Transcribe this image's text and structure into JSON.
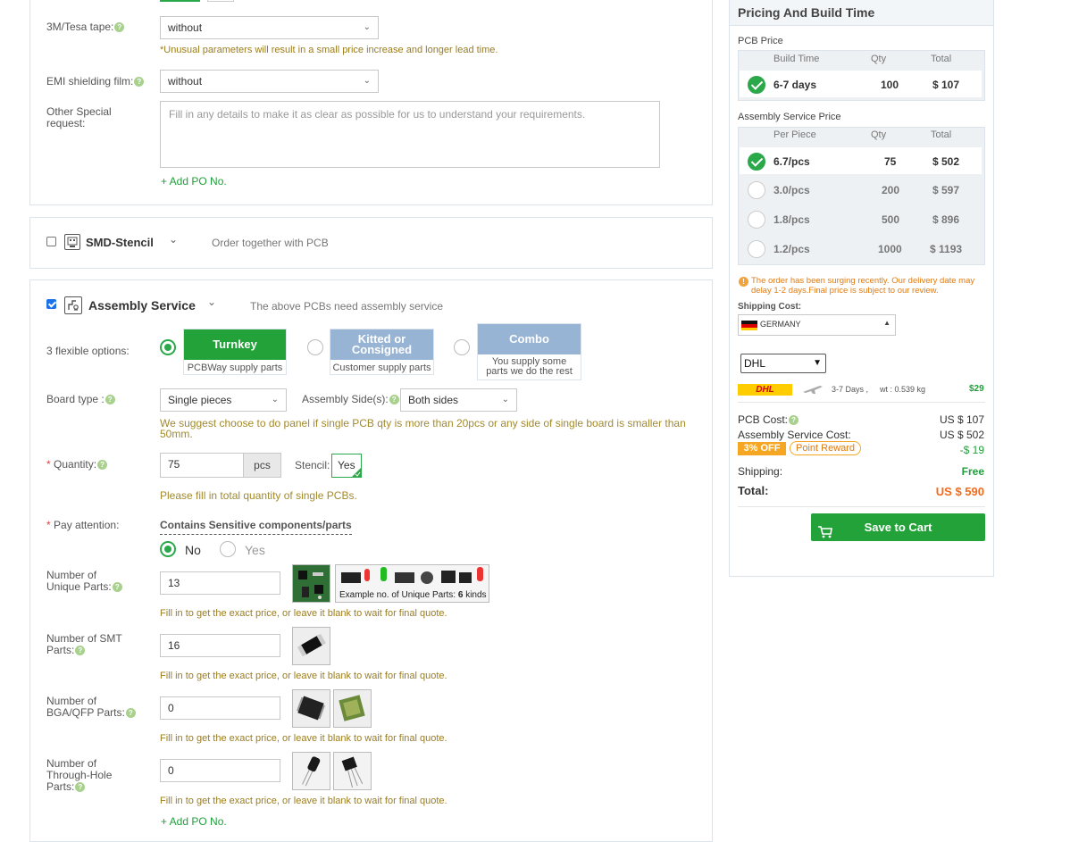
{
  "form": {
    "tesa": {
      "label": "3M/Tesa tape:",
      "value": "without",
      "hint": "*Unusual parameters will result in a small price increase and longer lead time."
    },
    "emi": {
      "label": "EMI shielding film:",
      "value": "without"
    },
    "other": {
      "label": "Other Special request:",
      "placeholder": "Fill in any details to make it as clear as possible for us to understand your requirements."
    },
    "add_po_1": "+ Add PO No.",
    "smd": {
      "title": "SMD-Stencil",
      "note": "Order together with PCB"
    },
    "assembly": {
      "title": "Assembly Service",
      "note": "The above PCBs need assembly service",
      "options_label": "3 flexible options:",
      "options": [
        {
          "head": "Turnkey",
          "sub": "PCBWay supply parts",
          "color": "#23a239"
        },
        {
          "head": "Kitted or Consigned",
          "sub": "Customer supply parts",
          "color": "#98b4d4"
        },
        {
          "head": "Combo",
          "sub": "You supply some parts we do the rest",
          "color": "#98b4d4"
        }
      ],
      "board_type": {
        "label": "Board type :",
        "value": "Single pieces"
      },
      "sides": {
        "label": "Assembly Side(s):",
        "value": "Both sides"
      },
      "panel_hint": "We suggest choose to do panel if single PCB qty is more than 20pcs or any side of single board is smaller than 50mm.",
      "quantity": {
        "label": "Quantity:",
        "value": "75",
        "unit": "pcs",
        "stencil_label": "Stencil:",
        "stencil_value": "Yes",
        "hint": "Please fill in total quantity of single PCBs."
      },
      "attention": {
        "label": "Pay attention:",
        "heading": "Contains Sensitive components/parts",
        "no": "No",
        "yes": "Yes"
      },
      "unique": {
        "label": "Number of Unique Parts:",
        "value": "13",
        "example_prefix": "Example no. of Unique Parts:",
        "example_num": "6",
        "example_suffix": "kinds"
      },
      "smt": {
        "label": "Number of SMT Parts:",
        "value": "16"
      },
      "bga": {
        "label": "Number of BGA/QFP Parts:",
        "value": "0"
      },
      "th": {
        "label": "Number of Through-Hole Parts:",
        "value": "0"
      },
      "parts_hint": "Fill in to get the exact price, or leave it blank to wait for final quote.",
      "add_po_2": "+ Add PO No."
    }
  },
  "sidebar": {
    "title": "Pricing And Build Time",
    "pcb_price": "PCB Price",
    "pcb_cols": [
      "Build Time",
      "Qty",
      "Total"
    ],
    "pcb_row": {
      "time": "6-7 days",
      "qty": "100",
      "total": "$ 107"
    },
    "asm_price": "Assembly Service Price",
    "asm_cols": [
      "Per Piece",
      "Qty",
      "Total"
    ],
    "asm_rows": [
      {
        "price": "6.7/pcs",
        "qty": "75",
        "total": "$ 502"
      },
      {
        "price": "3.0/pcs",
        "qty": "200",
        "total": "$ 597"
      },
      {
        "price": "1.8/pcs",
        "qty": "500",
        "total": "$ 896"
      },
      {
        "price": "1.2/pcs",
        "qty": "1000",
        "total": "$ 1193"
      }
    ],
    "warning": "The order has been surging recently. Our delivery date may delay 1-2 days.Final price is subject to our review.",
    "shipping_cost_label": "Shipping Cost:",
    "country": "GERMANY",
    "carrier": "DHL",
    "carrier_logo": "DHL",
    "ship_time": "3-7 Days ,",
    "ship_weight": "wt : 0.539 kg",
    "ship_price": "$29",
    "pcb_cost_label": "PCB Cost:",
    "pcb_cost": "US $ 107",
    "asm_cost_label": "Assembly Service Cost:",
    "asm_cost": "US $ 502",
    "off_badge": "3% OFF",
    "reward_badge": "Point Reward",
    "discount": "-$ 19",
    "shipping_label": "Shipping:",
    "shipping_value": "Free",
    "total_label": "Total:",
    "total_value": "US $ 590",
    "save_label": "Save to Cart"
  },
  "colors": {
    "green": "#23a239",
    "brand_orange": "#f26b1d",
    "hint": "#a28a2d"
  }
}
